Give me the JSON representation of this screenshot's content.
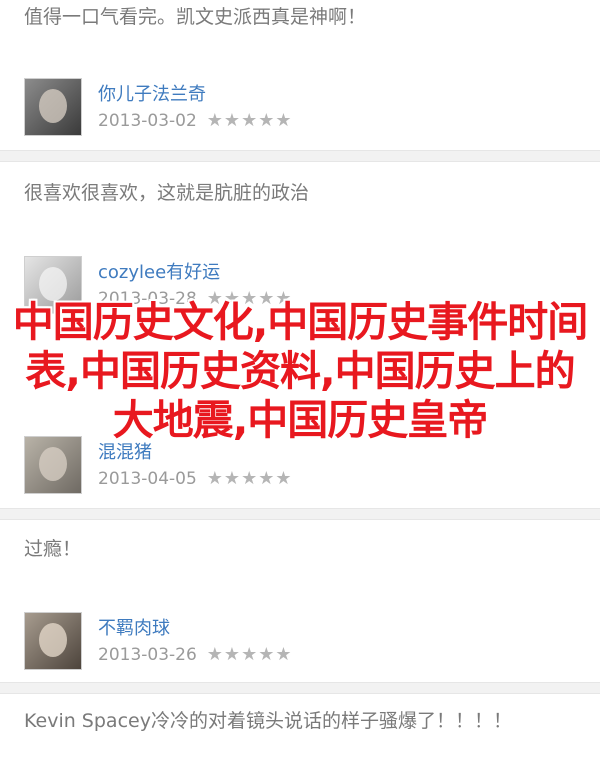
{
  "comments": [
    {
      "text": "值得一口气看完。凯文史派西真是神啊！"
    },
    {
      "username": "你儿子法兰奇",
      "date": "2013-03-02",
      "stars": "★★★★★"
    },
    {
      "text": "很喜欢很喜欢，这就是肮脏的政治"
    },
    {
      "username": "cozylee有好运",
      "date": "2013-03-28",
      "stars": "★★★★★"
    },
    {
      "username": "混混猪",
      "date": "2013-04-05",
      "stars": "★★★★★"
    },
    {
      "text": "过瘾！"
    },
    {
      "username": "不羁肉球",
      "date": "2013-03-26",
      "stars": "★★★★★"
    },
    {
      "text": "Kevin Spacey冷冷的对着镜头说话的样子骚爆了！！！！"
    }
  ],
  "overlay": {
    "title": "中国历史文化,中国历史事件时间表,中国历史资料,中国历史上的大地震,中国历史皇帝"
  }
}
